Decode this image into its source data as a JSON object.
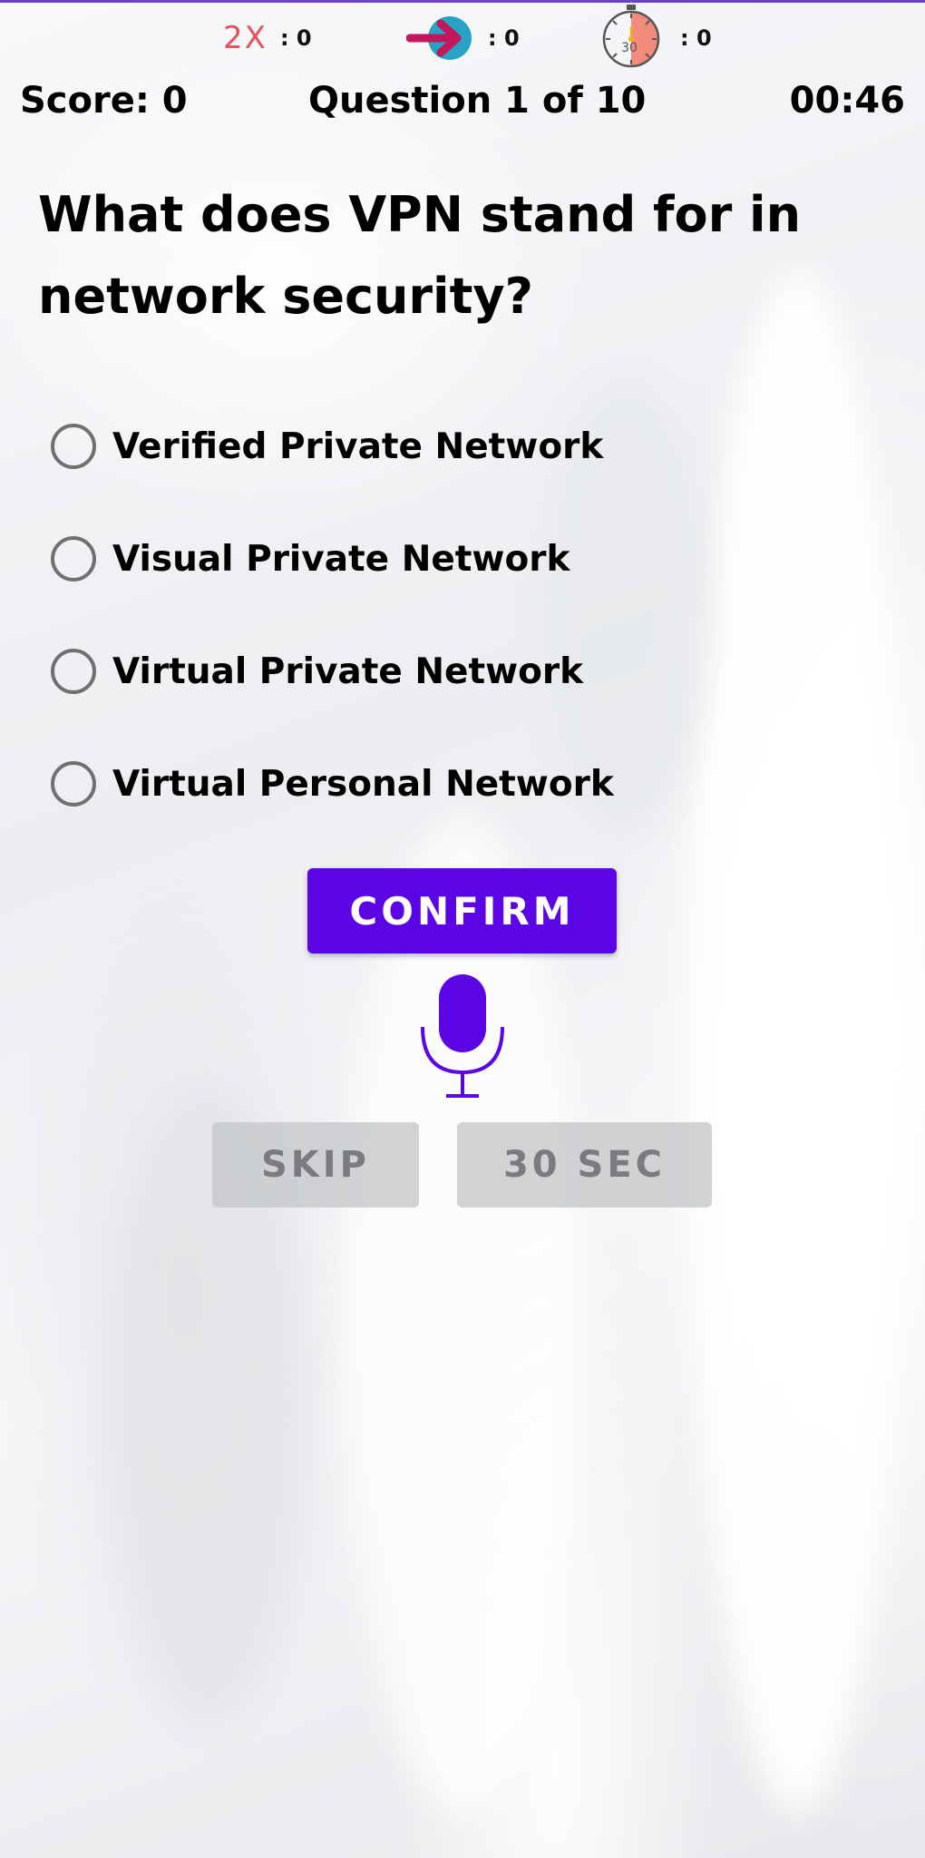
{
  "lifelines": {
    "double_label": "2X",
    "double_count": ": 0",
    "skip_count": ": 0",
    "time_label": "30",
    "time_count": ": 0"
  },
  "status": {
    "score": "Score: 0",
    "question_progress": "Question 1 of 10",
    "timer": "00:46"
  },
  "question": {
    "text": "What does VPN stand for in network security?"
  },
  "options": [
    {
      "label": "Verified Private Network"
    },
    {
      "label": "Visual Private Network"
    },
    {
      "label": "Virtual Private Network"
    },
    {
      "label": "Virtual Personal Network"
    }
  ],
  "actions": {
    "confirm_label": "CONFIRM",
    "skip_label": "SKIP",
    "time_label": "30 SEC"
  },
  "colors": {
    "accent": "#5b04e6",
    "double": "#e2535f",
    "skip_circle": "#27a3c6",
    "skip_arrow": "#c2185b"
  }
}
